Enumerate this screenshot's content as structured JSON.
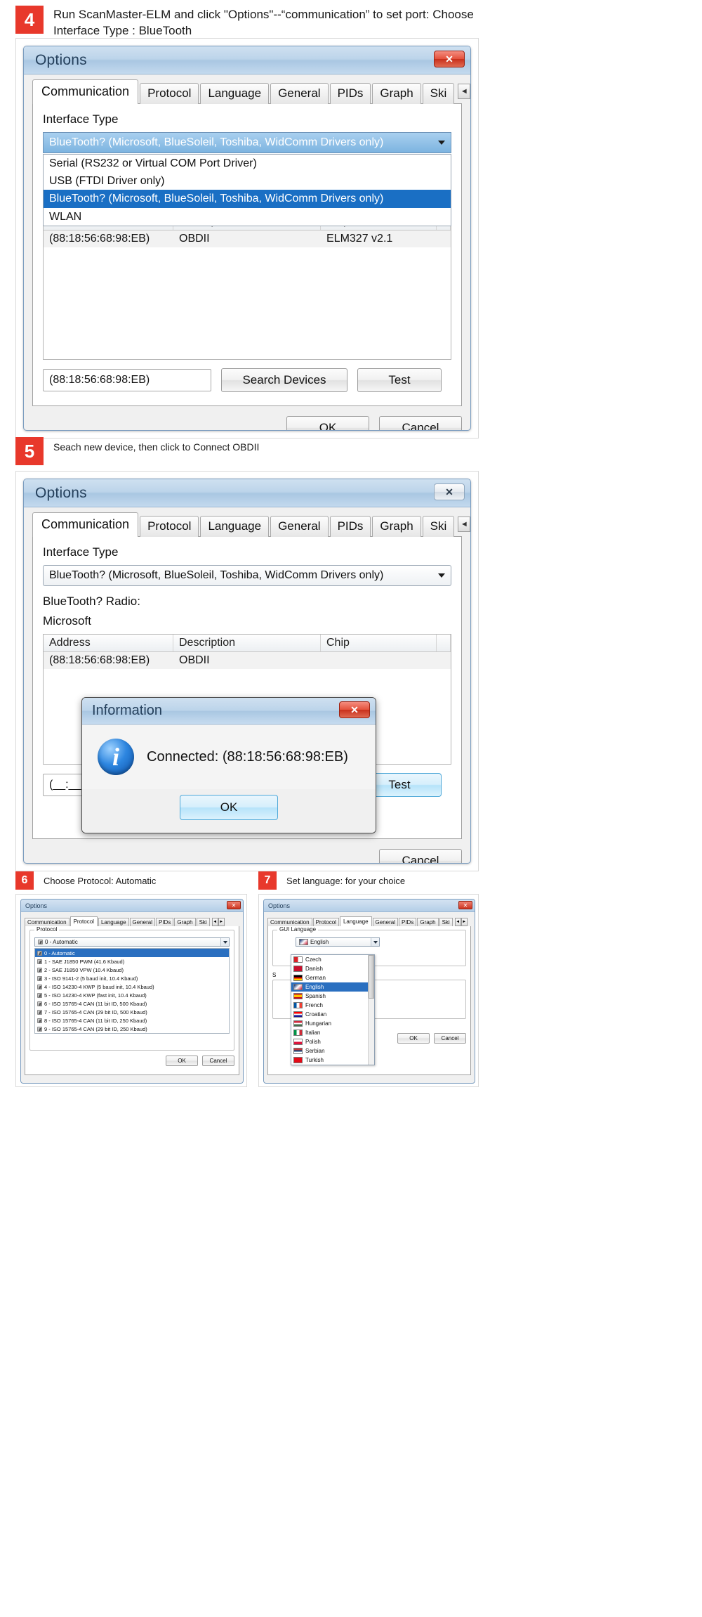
{
  "steps": {
    "four": {
      "number": "4",
      "text": "Run ScanMaster-ELM and click \"Options\"--“communication” to set port: Choose Interface Type : BlueTooth"
    },
    "five": {
      "number": "5",
      "text": "Seach new device, then click to Connect OBDII"
    },
    "six": {
      "number": "6",
      "text": "Choose Protocol: Automatic"
    },
    "seven": {
      "number": "7",
      "text": "Set language: for your choice"
    }
  },
  "options_dialog": {
    "title": "Options",
    "close_label": "✕",
    "tabs": [
      {
        "label": "Communication",
        "active": true
      },
      {
        "label": "Protocol",
        "active": false
      },
      {
        "label": "Language",
        "active": false
      },
      {
        "label": "General",
        "active": false
      },
      {
        "label": "PIDs",
        "active": false
      },
      {
        "label": "Graph",
        "active": false
      },
      {
        "label": "Ski",
        "active": false
      }
    ],
    "tab_scroll": {
      "left": "◄",
      "right": "►"
    },
    "interface_label": "Interface Type",
    "interface_selected": "BlueTooth? (Microsoft, BlueSoleil, Toshiba, WidComm Drivers only)",
    "interface_options": [
      {
        "label": "Serial (RS232 or Virtual COM Port Driver)",
        "selected": false
      },
      {
        "label": "USB (FTDI Driver only)",
        "selected": false
      },
      {
        "label": "BlueTooth? (Microsoft, BlueSoleil, Toshiba, WidComm Drivers only)",
        "selected": true
      },
      {
        "label": "WLAN",
        "selected": false
      }
    ],
    "radio_label": "BlueTooth? Radio:",
    "radio_value": "Microsoft",
    "grid": {
      "headers": [
        "Address",
        "Description",
        "Chip",
        ""
      ],
      "rows": [
        {
          "address": "(88:18:56:68:98:EB)",
          "description": "OBDII",
          "chip": "ELM327 v2.1",
          "extra": ""
        }
      ]
    },
    "address_input_value": "(88:18:56:68:98:EB)",
    "address_input_value_step5": "(__:__",
    "search_button": "Search Devices",
    "test_button": "Test",
    "ok_button": "OK",
    "cancel_button": "Cancel"
  },
  "information_dialog": {
    "title": "Information",
    "close_label": "✕",
    "message": "Connected: (88:18:56:68:98:EB)",
    "ok_button": "OK",
    "icon": "information-icon"
  },
  "protocol_panel": {
    "title": "Options",
    "close_label": "✕",
    "tabs": [
      {
        "label": "Communication",
        "active": false
      },
      {
        "label": "Protocol",
        "active": true
      },
      {
        "label": "Language",
        "active": false
      },
      {
        "label": "General",
        "active": false
      },
      {
        "label": "PIDs",
        "active": false
      },
      {
        "label": "Graph",
        "active": false
      },
      {
        "label": "Ski",
        "active": false
      }
    ],
    "group_legend": "Protocol",
    "selected": "0 - Automatic",
    "options": [
      {
        "label": "0 - Automatic",
        "selected": true
      },
      {
        "label": "1 - SAE J1850 PWM (41.6 Kbaud)",
        "selected": false
      },
      {
        "label": "2 - SAE J1850 VPW (10.4 Kbaud)",
        "selected": false
      },
      {
        "label": "3 - ISO 9141-2 (5 baud init, 10.4 Kbaud)",
        "selected": false
      },
      {
        "label": "4 - ISO 14230-4 KWP (5 baud init, 10.4 Kbaud)",
        "selected": false
      },
      {
        "label": "5 - ISO 14230-4 KWP (fast init, 10.4 Kbaud)",
        "selected": false
      },
      {
        "label": "6 - ISO 15765-4 CAN (11 bit ID, 500 Kbaud)",
        "selected": false
      },
      {
        "label": "7 - ISO 15765-4 CAN (29 bit ID, 500 Kbaud)",
        "selected": false
      },
      {
        "label": "8 - ISO 15765-4 CAN (11 bit ID, 250 Kbaud)",
        "selected": false
      },
      {
        "label": "9 - ISO 15765-4 CAN (29 bit ID, 250 Kbaud)",
        "selected": false
      }
    ],
    "ok_button": "OK",
    "cancel_button": "Cancel"
  },
  "language_panel": {
    "title": "Options",
    "close_label": "✕",
    "tabs": [
      {
        "label": "Communication",
        "active": false
      },
      {
        "label": "Protocol",
        "active": false
      },
      {
        "label": "Language",
        "active": true
      },
      {
        "label": "General",
        "active": false
      },
      {
        "label": "PIDs",
        "active": false
      },
      {
        "label": "Graph",
        "active": false
      },
      {
        "label": "Ski",
        "active": false
      }
    ],
    "group_legend": "GUI Language",
    "selected": "English",
    "side_label": "S",
    "options": [
      {
        "label": "Czech",
        "selected": false,
        "flag": "#d8232a"
      },
      {
        "label": "Danish",
        "selected": false,
        "flag": "#c8102e"
      },
      {
        "label": "German",
        "selected": false,
        "flag": "#000000"
      },
      {
        "label": "English",
        "selected": true,
        "flag": "#012169"
      },
      {
        "label": "Spanish",
        "selected": false,
        "flag": "#c60b1e"
      },
      {
        "label": "French",
        "selected": false,
        "flag": "#0055a4"
      },
      {
        "label": "Croatian",
        "selected": false,
        "flag": "#ff0000"
      },
      {
        "label": "Hungarian",
        "selected": false,
        "flag": "#cd2a3e"
      },
      {
        "label": "Italian",
        "selected": false,
        "flag": "#009246"
      },
      {
        "label": "Polish",
        "selected": false,
        "flag": "#dc143c"
      },
      {
        "label": "Serbian",
        "selected": false,
        "flag": "#c6363c"
      },
      {
        "label": "Turkish",
        "selected": false,
        "flag": "#e30a17"
      }
    ],
    "ok_button": "OK",
    "cancel_button": "Cancel"
  }
}
